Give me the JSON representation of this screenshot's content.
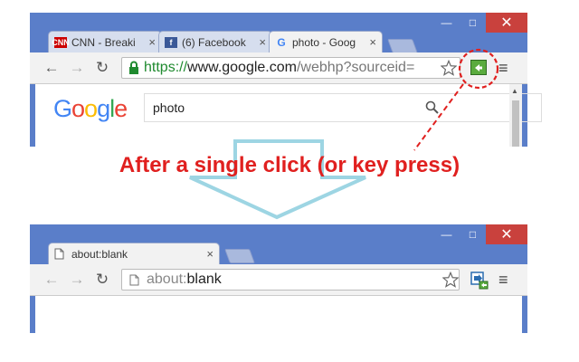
{
  "before": {
    "tabs": [
      {
        "label": "CNN - Breaki",
        "favicon": "CNN",
        "close": "×"
      },
      {
        "label": "(6) Facebook",
        "favicon": "f",
        "close": "×"
      },
      {
        "label": "photo - Goog",
        "favicon": "G",
        "close": "×",
        "active": true
      }
    ],
    "nav": {
      "back": "←",
      "forward": "→",
      "reload": "↻"
    },
    "address": {
      "scheme": "https://",
      "host": "www.google.com",
      "path": "/webhp?sourceid="
    },
    "google_logo": {
      "letters": [
        "G",
        "o",
        "o",
        "g",
        "l",
        "e"
      ],
      "colors": [
        "#4285f4",
        "#ea4335",
        "#fbbc05",
        "#4285f4",
        "#34a853",
        "#ea4335"
      ]
    },
    "search_value": "photo"
  },
  "caption": "After a single click (or key press)",
  "after": {
    "tab": {
      "label": "about:blank",
      "close": "×"
    },
    "nav": {
      "back": "←",
      "forward": "→",
      "reload": "↻"
    },
    "address": {
      "scheme": "about:",
      "rest": "blank"
    }
  },
  "window_controls": {
    "minimize": "—",
    "maximize": "□",
    "close": "✕"
  },
  "colors": {
    "frame": "#5a7ec9",
    "close": "#c9413d",
    "caption": "#e0201f",
    "arrow": "#9dd5e3",
    "extension": "#5aab3e",
    "https": "#1f8a2f"
  },
  "icons": {
    "star": "star-icon",
    "zoom": "magnifier-icon",
    "menu": "hamburger-menu-icon",
    "extension": "extension-arrow-icon"
  }
}
